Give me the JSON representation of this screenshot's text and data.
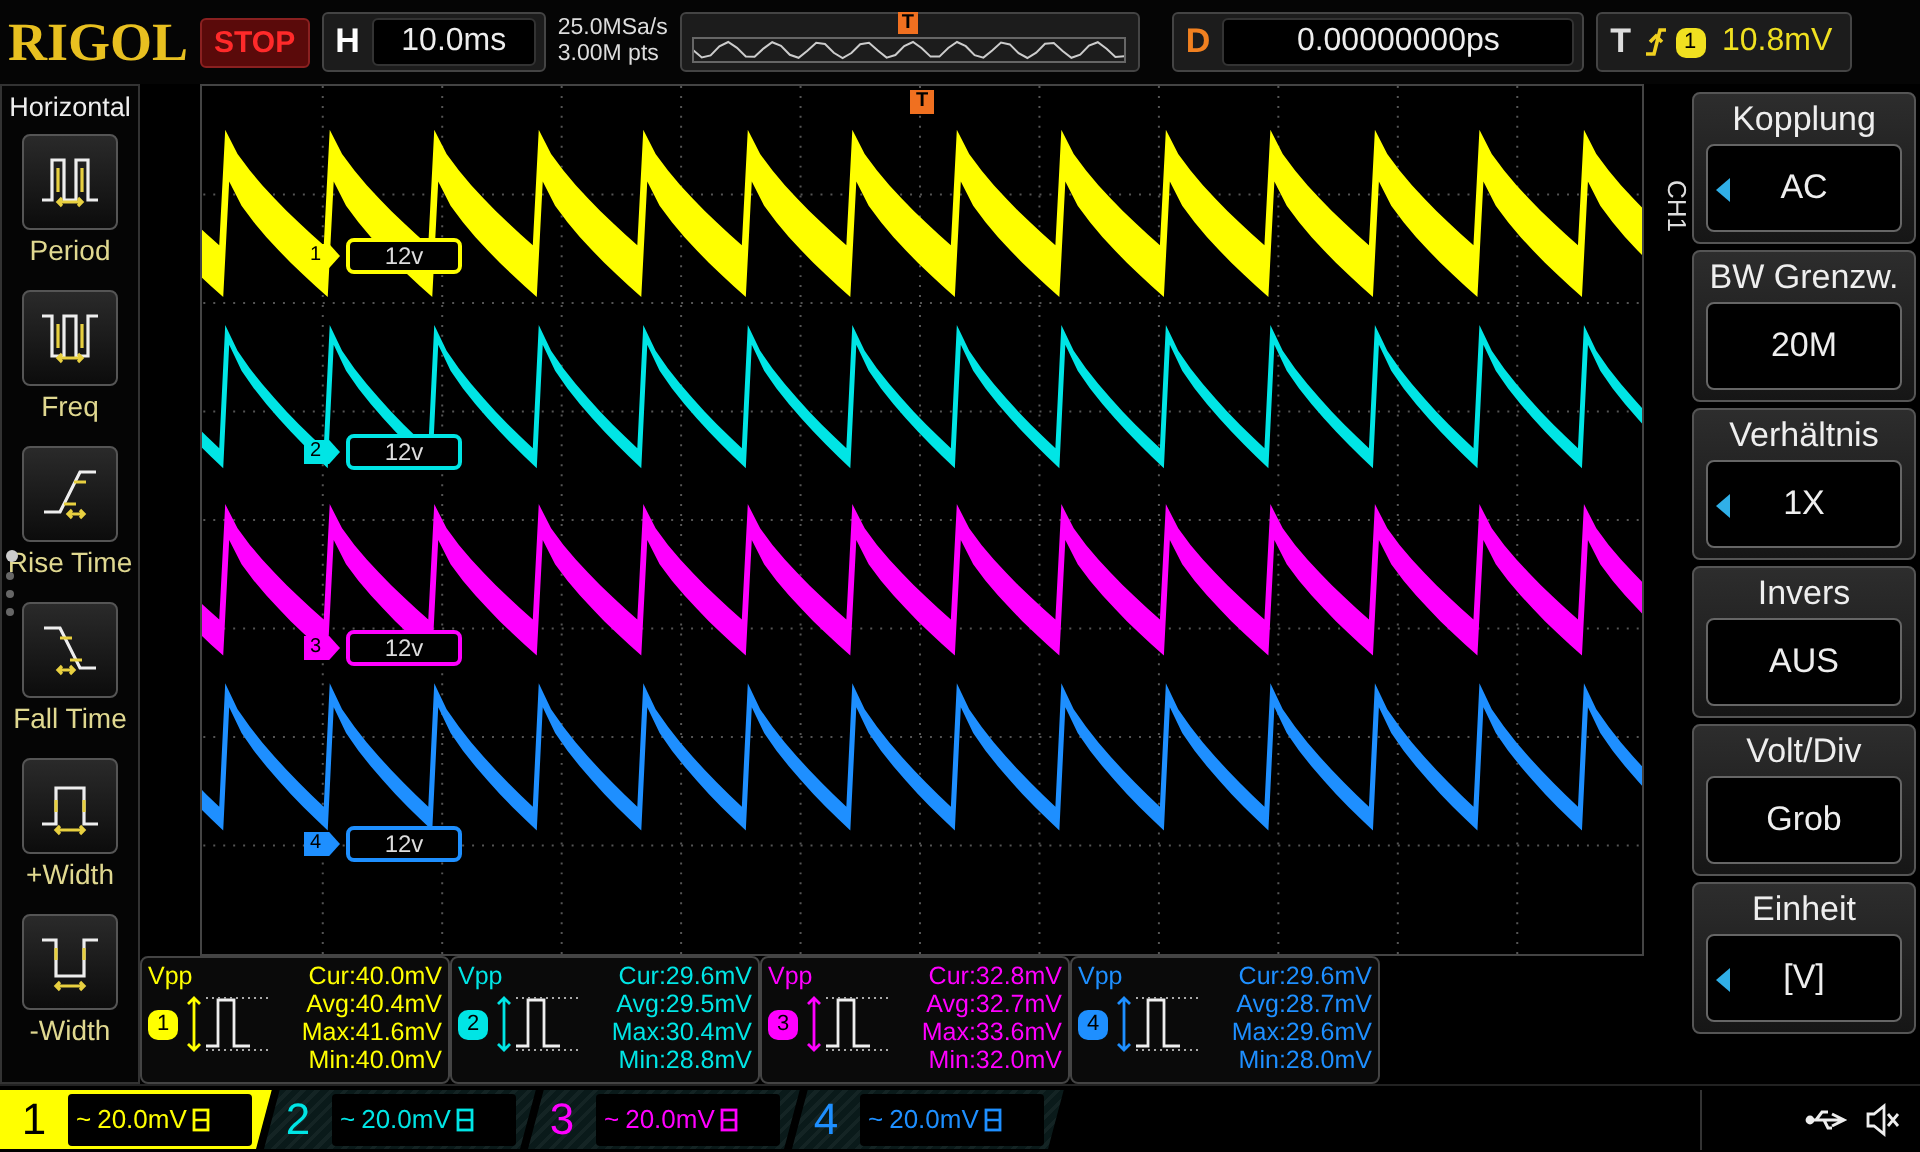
{
  "header": {
    "logo": "RIGOL",
    "run_state": "STOP",
    "timebase": {
      "label": "H",
      "value": "10.0ms"
    },
    "sample_rate": "25.0MSa/s",
    "memory_depth": "3.00M pts",
    "overview_marker": "T",
    "delay": {
      "label": "D",
      "value": "0.00000000ps"
    },
    "trigger": {
      "label": "T",
      "source": "1",
      "level": "10.8mV"
    }
  },
  "grid_trigger_marker": "T",
  "left_menu": {
    "title": "Horizontal",
    "items": [
      {
        "label": "Period",
        "kind": "period"
      },
      {
        "label": "Freq",
        "kind": "freq"
      },
      {
        "label": "Rise Time",
        "kind": "rise"
      },
      {
        "label": "Fall Time",
        "kind": "fall"
      },
      {
        "label": "+Width",
        "kind": "pwidth"
      },
      {
        "label": "-Width",
        "kind": "nwidth"
      }
    ]
  },
  "channels": [
    {
      "number": "1",
      "marker": "1",
      "color": "#ffff00",
      "offset_label": "12v",
      "coupling": "~",
      "scale": "20.0mV",
      "selected": true
    },
    {
      "number": "2",
      "marker": "2",
      "color": "#00e5e5",
      "offset_label": "12v",
      "coupling": "~",
      "scale": "20.0mV",
      "selected": false
    },
    {
      "number": "3",
      "marker": "3",
      "color": "#ff00ff",
      "offset_label": "12v",
      "coupling": "~",
      "scale": "20.0mV",
      "selected": false
    },
    {
      "number": "4",
      "marker": "4",
      "color": "#1e8fff",
      "offset_label": "12v",
      "coupling": "~",
      "scale": "20.0mV",
      "selected": false
    }
  ],
  "measurements": [
    {
      "type": "Vpp",
      "channel": "1",
      "color": "#ffff00",
      "lines": [
        "Cur:40.0mV",
        "Avg:40.4mV",
        "Max:41.6mV",
        "Min:40.0mV"
      ]
    },
    {
      "type": "Vpp",
      "channel": "2",
      "color": "#00e5e5",
      "lines": [
        "Cur:29.6mV",
        "Avg:29.5mV",
        "Max:30.4mV",
        "Min:28.8mV"
      ]
    },
    {
      "type": "Vpp",
      "channel": "3",
      "color": "#ff00ff",
      "lines": [
        "Cur:32.8mV",
        "Avg:32.7mV",
        "Max:33.6mV",
        "Min:32.0mV"
      ]
    },
    {
      "type": "Vpp",
      "channel": "4",
      "color": "#1e8fff",
      "lines": [
        "Cur:29.6mV",
        "Avg:28.7mV",
        "Max:29.6mV",
        "Min:28.0mV"
      ]
    }
  ],
  "right_menu": {
    "channel": "CH1",
    "items": [
      {
        "title": "Kopplung",
        "value": "AC",
        "arrow": true
      },
      {
        "title": "BW Grenzw.",
        "value": "20M",
        "arrow": false
      },
      {
        "title": "Verhältnis",
        "value": "1X",
        "arrow": true
      },
      {
        "title": "Invers",
        "value": "AUS",
        "arrow": false
      },
      {
        "title": "Volt/Div",
        "value": "Grob",
        "arrow": false
      },
      {
        "title": "Einheit",
        "value": "[V]",
        "arrow": true
      }
    ]
  }
}
